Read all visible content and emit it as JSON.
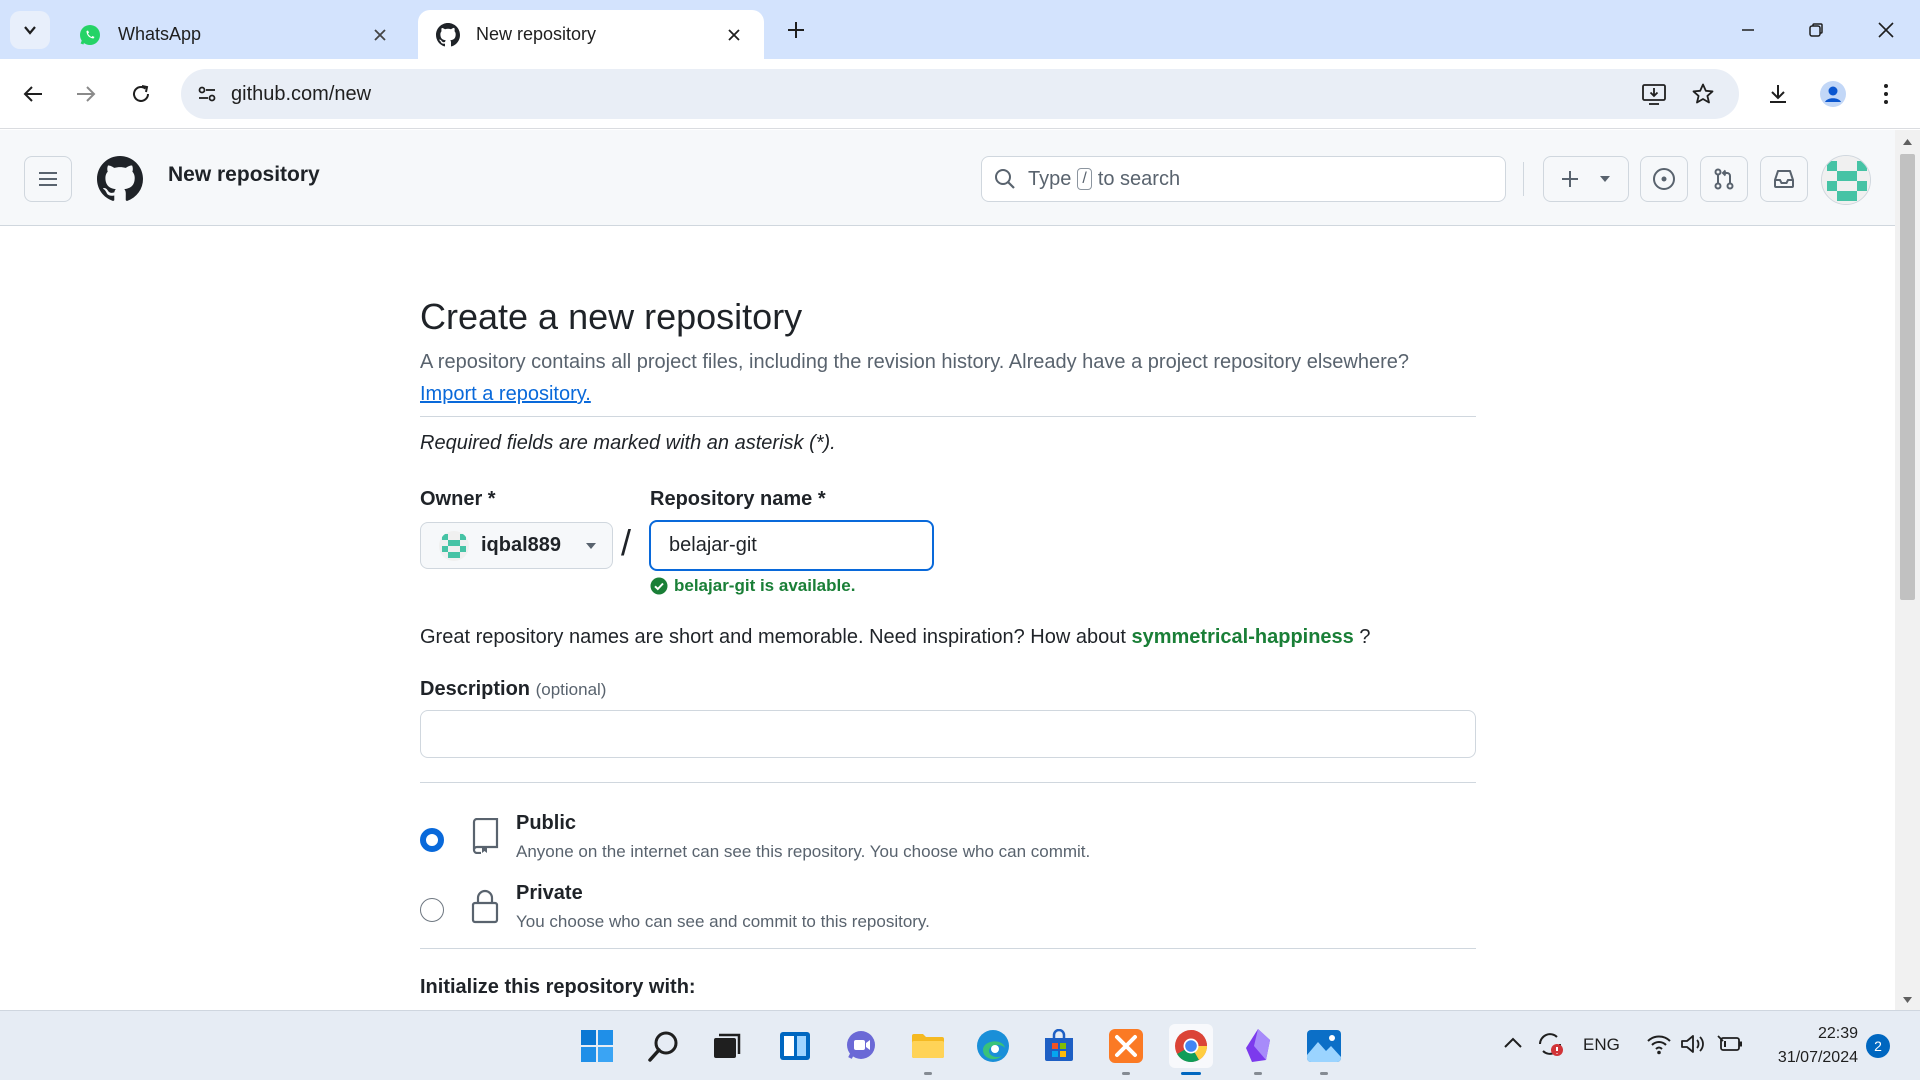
{
  "browser": {
    "tabs": [
      {
        "title": "WhatsApp",
        "icon": "whatsapp-icon",
        "active": false
      },
      {
        "title": "New repository",
        "icon": "github-icon",
        "active": true
      }
    ],
    "url": "github.com/new"
  },
  "github_header": {
    "page_title": "New repository",
    "search": {
      "prefix": "Type",
      "key": "/",
      "suffix": "to search"
    }
  },
  "form": {
    "heading": "Create a new repository",
    "subtitle": "A repository contains all project files, including the revision history. Already have a project repository elsewhere?",
    "import_link": "Import a repository.",
    "required_note": "Required fields are marked with an asterisk (*).",
    "owner_label": "Owner *",
    "owner_value": "iqbal889",
    "slash": "/",
    "repo_name_label": "Repository name *",
    "repo_name_value": "belajar-git",
    "availability": "belajar-git is available.",
    "inspiration_text": "Great repository names are short and memorable. Need inspiration? How about",
    "inspiration_suggestion": "symmetrical-happiness",
    "inspiration_end": "?",
    "description_label": "Description",
    "description_optional": "(optional)",
    "description_value": "",
    "visibility": [
      {
        "title": "Public",
        "description": "Anyone on the internet can see this repository. You choose who can commit.",
        "selected": true,
        "icon": "repo-icon"
      },
      {
        "title": "Private",
        "description": "You choose who can see and commit to this repository.",
        "selected": false,
        "icon": "lock-icon"
      }
    ],
    "initialize_label": "Initialize this repository with:"
  },
  "taskbar": {
    "apps": [
      "start",
      "search",
      "task-view",
      "widgets",
      "chat",
      "file-explorer",
      "edge",
      "store",
      "xampp",
      "chrome",
      "obsidian",
      "photos"
    ],
    "active_app": "chrome",
    "language": "ENG",
    "time": "22:39",
    "date": "31/07/2024",
    "notification_count": "2"
  },
  "colors": {
    "accent": "#0969da",
    "success": "#1a7f37",
    "tabstrip": "#d3e3fd",
    "identicon": "#46c3a5"
  }
}
